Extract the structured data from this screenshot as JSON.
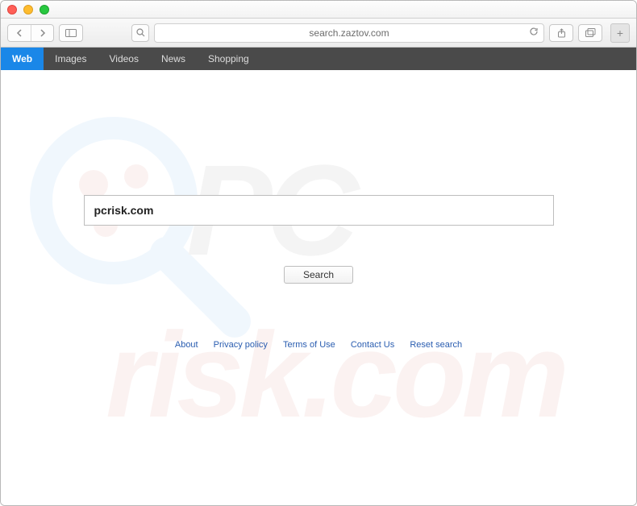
{
  "addressbar": {
    "url": "search.zaztov.com"
  },
  "nav": {
    "items": [
      {
        "label": "Web",
        "active": true
      },
      {
        "label": "Images",
        "active": false
      },
      {
        "label": "Videos",
        "active": false
      },
      {
        "label": "News",
        "active": false
      },
      {
        "label": "Shopping",
        "active": false
      }
    ]
  },
  "search": {
    "value": "pcrisk.com",
    "button_label": "Search"
  },
  "footer": {
    "links": [
      "About",
      "Privacy policy",
      "Terms of Use",
      "Contact Us",
      "Reset search"
    ]
  },
  "watermark": {
    "line1": "PC",
    "line2": "risk.com"
  }
}
